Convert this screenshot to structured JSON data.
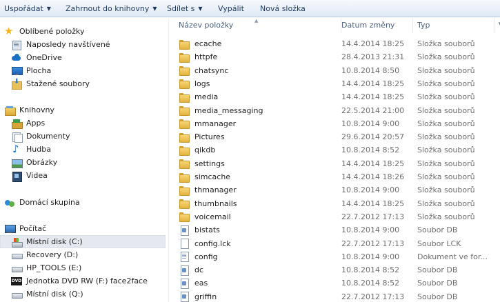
{
  "toolbar": {
    "organize": "Uspořádat",
    "include_library": "Zahrnout do knihovny",
    "share": "Sdílet s",
    "burn": "Vypálit",
    "new_folder": "Nová složka"
  },
  "nav": {
    "favorites": "Oblíbené položky",
    "recent": "Naposledy navštívené",
    "onedrive": "OneDrive",
    "desktop": "Plocha",
    "downloads": "Stažené soubory",
    "libraries": "Knihovny",
    "apps": "Apps",
    "documents": "Dokumenty",
    "music": "Hudba",
    "pictures": "Obrázky",
    "videos": "Videa",
    "homegroup": "Domácí skupina",
    "computer": "Počítač",
    "drive_c": "Místní disk (C:)",
    "drive_d": "Recovery (D:)",
    "drive_e": "HP_TOOLS (E:)",
    "drive_f": "Jednotka DVD RW (F:) face2face",
    "drive_q": "Místní disk (Q:)"
  },
  "columns": {
    "name": "Název položky",
    "date": "Datum změny",
    "type": "Typ",
    "size": "Ve"
  },
  "files": [
    {
      "name": "ecache",
      "date": "14.4.2014 18:25",
      "type": "Složka souborů",
      "icon": "folder-icon"
    },
    {
      "name": "httpfe",
      "date": "28.4.2013 21:31",
      "type": "Složka souborů",
      "icon": "folder-icon"
    },
    {
      "name": "chatsync",
      "date": "10.8.2014 8:50",
      "type": "Složka souborů",
      "icon": "folder-icon"
    },
    {
      "name": "logs",
      "date": "14.4.2014 18:25",
      "type": "Složka souborů",
      "icon": "folder-icon"
    },
    {
      "name": "media",
      "date": "14.4.2014 18:25",
      "type": "Složka souborů",
      "icon": "folder-icon"
    },
    {
      "name": "media_messaging",
      "date": "22.5.2014 21:00",
      "type": "Složka souborů",
      "icon": "folder-icon"
    },
    {
      "name": "mmanager",
      "date": "10.8.2014 9:00",
      "type": "Složka souborů",
      "icon": "folder-icon"
    },
    {
      "name": "Pictures",
      "date": "29.6.2014 20:57",
      "type": "Složka souborů",
      "icon": "folder-icon"
    },
    {
      "name": "qikdb",
      "date": "10.8.2014 8:52",
      "type": "Složka souborů",
      "icon": "folder-icon"
    },
    {
      "name": "settings",
      "date": "14.4.2014 18:25",
      "type": "Složka souborů",
      "icon": "folder-icon"
    },
    {
      "name": "simcache",
      "date": "14.4.2014 18:26",
      "type": "Složka souborů",
      "icon": "folder-icon"
    },
    {
      "name": "thmanager",
      "date": "10.8.2014 9:00",
      "type": "Složka souborů",
      "icon": "folder-icon"
    },
    {
      "name": "thumbnails",
      "date": "14.4.2014 18:25",
      "type": "Složka souborů",
      "icon": "folder-icon"
    },
    {
      "name": "voicemail",
      "date": "22.7.2012 17:13",
      "type": "Složka souborů",
      "icon": "folder-icon"
    },
    {
      "name": "bistats",
      "date": "10.8.2014 9:00",
      "type": "Soubor DB",
      "icon": "db-file-icon"
    },
    {
      "name": "config.lck",
      "date": "22.7.2012 17:13",
      "type": "Soubor LCK",
      "icon": "lck-file-icon"
    },
    {
      "name": "config",
      "date": "10.8.2014 9:00",
      "type": "Dokument ve for...",
      "icon": "document-file-icon"
    },
    {
      "name": "dc",
      "date": "10.8.2014 8:52",
      "type": "Soubor DB",
      "icon": "db-file-icon"
    },
    {
      "name": "eas",
      "date": "10.8.2014 8:52",
      "type": "Soubor DB",
      "icon": "db-file-icon"
    },
    {
      "name": "griffin",
      "date": "22.7.2012 17:13",
      "type": "Soubor DB",
      "icon": "db-file-icon"
    }
  ]
}
